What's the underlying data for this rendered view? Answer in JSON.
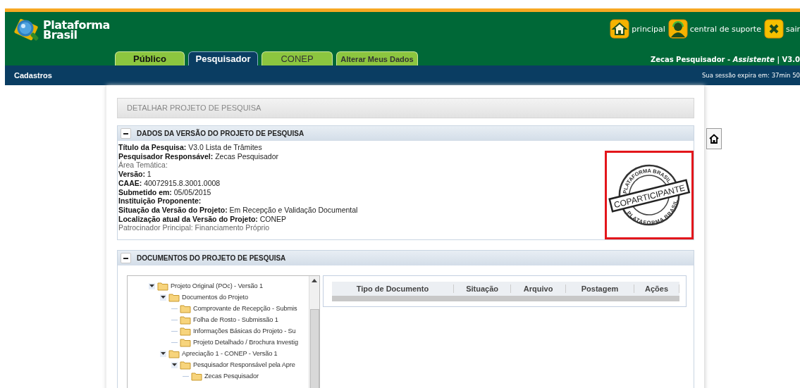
{
  "header": {
    "logo_lines": [
      "Plataforma",
      "Brasil"
    ],
    "links": [
      {
        "kind": "home",
        "label": "principal"
      },
      {
        "kind": "support",
        "label": "central de suporte"
      },
      {
        "kind": "exit",
        "label": "sair"
      }
    ],
    "user_line": "Zecas Pesquisador - *Assistente* | V3.0"
  },
  "tabs": [
    {
      "label": "Público",
      "selected": false,
      "kind": "main"
    },
    {
      "label": "Pesquisador",
      "selected": true,
      "kind": "main"
    },
    {
      "label": "CONEP",
      "selected": false,
      "kind": "plain"
    },
    {
      "label": "Alterar Meus Dados",
      "selected": false,
      "kind": "small"
    }
  ],
  "nav": {
    "menu": "Cadastros",
    "session": "Sua sessão expira em: 37min 50"
  },
  "page_title": "DETALHAR PROJETO DE PESQUISA",
  "version_section": {
    "title": "DADOS DA VERSÃO DO PROJETO DE PESQUISA",
    "expanded": true,
    "fields": [
      {
        "label": "Título da Pesquisa:",
        "value": "V3.0 Lista de Trâmites",
        "muted": false
      },
      {
        "label": "Pesquisador Responsável:",
        "value": "Zecas Pesquisador",
        "muted": false
      },
      {
        "label": "Área Temática:",
        "muted": true
      },
      {
        "label": "Versão:",
        "value": "1",
        "muted": false
      },
      {
        "label": "CAAE:",
        "value": "40072915.8.3001.0008",
        "muted": false
      },
      {
        "label": "Submetido em:",
        "value": "05/05/2015",
        "muted": false
      },
      {
        "label": "Instituição Proponente:",
        "muted": false
      },
      {
        "label": "Situação da Versão do Projeto:",
        "value": "Em Recepção e Validação Documental",
        "muted": false
      },
      {
        "label": "Localização atual da Versão do Projeto:",
        "value": "CONEP",
        "muted": false
      },
      {
        "label": "Patrocinador Principal:",
        "value": "Financiamento Próprio",
        "muted": true
      }
    ],
    "stamp": {
      "ring_top": "PLATAFORMA BRASIL",
      "ring_bottom": "PLATAFORMA BRASIL",
      "banner": "COPARTICIPANTE"
    }
  },
  "documents_section": {
    "title": "DOCUMENTOS DO PROJETO DE PESQUISA",
    "expanded": true,
    "tree": [
      {
        "label": "Projeto Original (POc) - Versão 1",
        "expanded": true,
        "children": [
          {
            "label": "Documentos do Projeto",
            "expanded": true,
            "children": [
              {
                "label": "Comprovante de Recepção - Submis"
              },
              {
                "label": "Folha de Rosto - Submissão 1"
              },
              {
                "label": "Informações Básicas do Projeto - Su"
              },
              {
                "label": "Projeto Detalhado / Brochura Investig"
              }
            ]
          },
          {
            "label": "Apreciação 1 - CONEP - Versão 1",
            "expanded": true,
            "children": [
              {
                "label": "Pesquisador Responsável pela Apre",
                "expanded": true,
                "children": [
                  {
                    "label": "Zecas Pesquisador"
                  }
                ]
              }
            ]
          }
        ]
      }
    ],
    "table": {
      "columns": [
        "Tipo de Documento",
        "Situação",
        "Arquivo",
        "Postagem",
        "Ações"
      ]
    }
  }
}
